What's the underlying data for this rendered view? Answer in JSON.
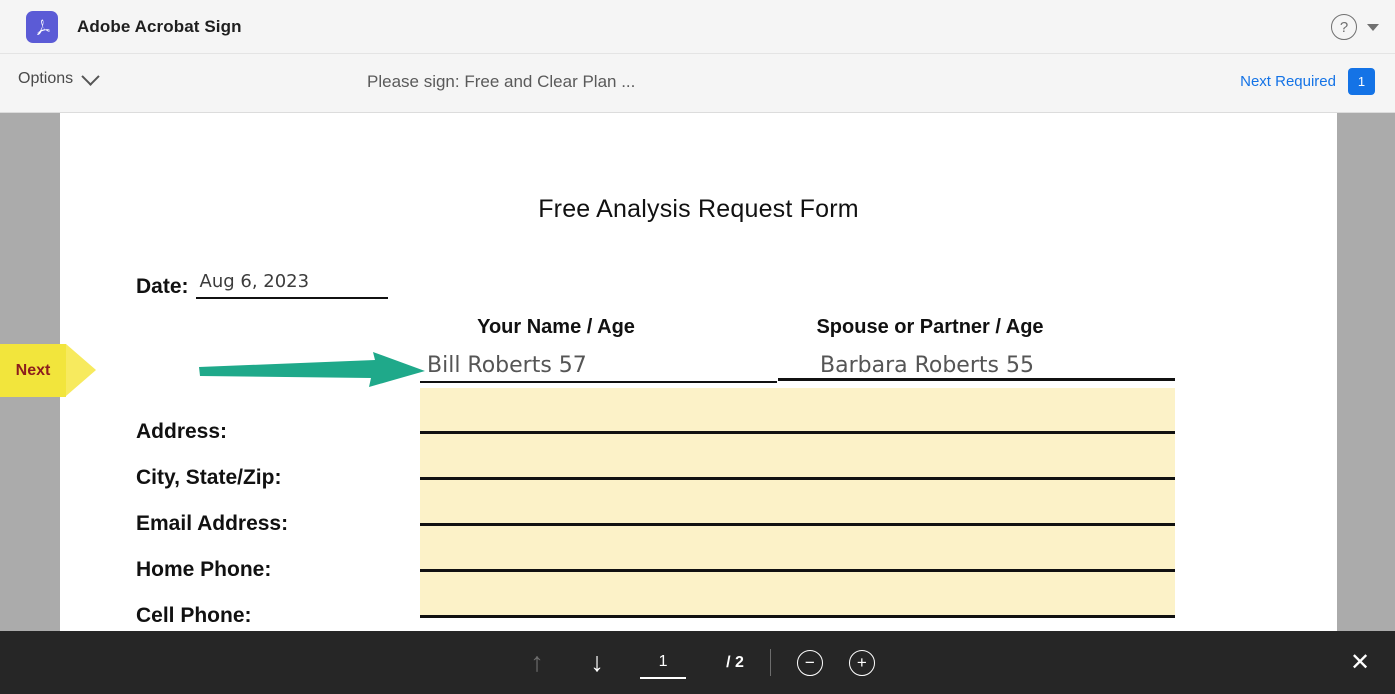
{
  "app": {
    "brand_title": "Adobe Acrobat Sign",
    "logo_icon": "adobe-acrobat-icon",
    "help_icon": "help-question-icon",
    "account_caret_icon": "chevron-down-icon"
  },
  "toolbar": {
    "options_label": "Options",
    "options_caret_icon": "chevron-down-icon",
    "document_title": "Please sign: Free and Clear Plan ...",
    "next_required_label": "Next Required",
    "next_required_count": "1",
    "accent_blue": "#1473e6"
  },
  "document": {
    "heading": "Free Analysis Request Form",
    "date_label": "Date:",
    "date_value": "Aug 6, 2023",
    "columns": [
      {
        "header": "Your Name / Age",
        "value": "Bill Roberts 57"
      },
      {
        "header": "Spouse or Partner / Age",
        "value": "Barbara Roberts 55"
      }
    ],
    "field_labels": [
      "Address:",
      "City, State/Zip:",
      "Email Address:",
      "Home Phone:",
      "Cell Phone:"
    ],
    "field_values": [
      "",
      "",
      "",
      "",
      ""
    ],
    "field_highlight_color": "#fcf2c8"
  },
  "next_marker": {
    "label": "Next",
    "background": "#f2e53c",
    "text_color": "#8c1d1d"
  },
  "pointer": {
    "icon": "green-arrow-pointer",
    "color": "#1fa98a"
  },
  "bottombar": {
    "previous_page_icon": "arrow-up-icon",
    "next_page_icon": "arrow-down-icon",
    "page_number": "1",
    "page_total": "/ 2",
    "zoom_out_icon": "zoom-out-icon",
    "zoom_in_icon": "zoom-in-icon",
    "close_icon": "close-icon",
    "zoom_out_glyph": "−",
    "zoom_in_glyph": "+",
    "close_glyph": "✕",
    "arrow_up_glyph": "↑",
    "arrow_down_glyph": "↓"
  }
}
